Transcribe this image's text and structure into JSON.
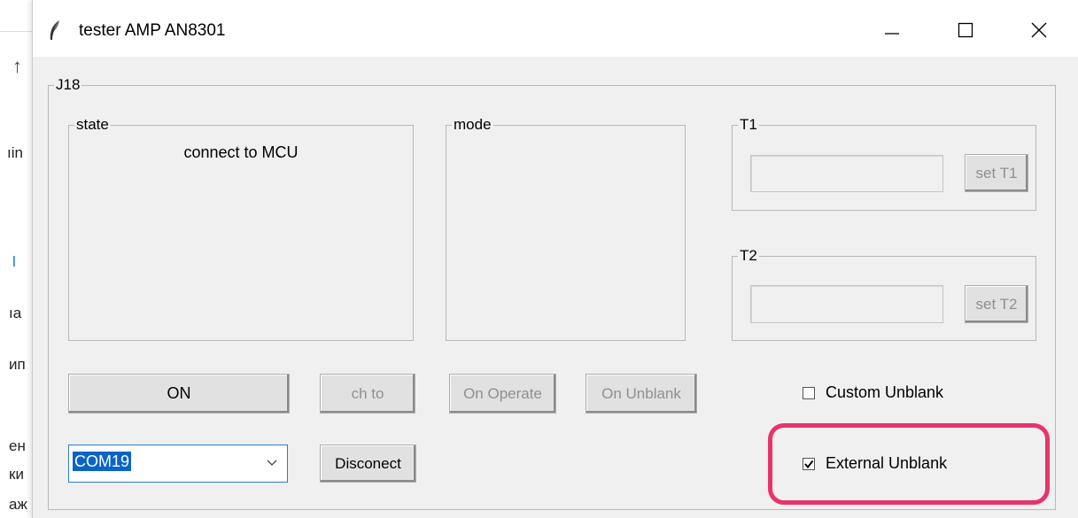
{
  "background": {
    "fragments": [
      "ıin",
      "ıа",
      "ип",
      "ен",
      "ки",
      "аж"
    ],
    "blue_fragment": "l"
  },
  "window": {
    "title": "tester AMP AN8301",
    "icons": {
      "app": "feather-icon",
      "minimize": "minimize-icon",
      "maximize": "maximize-icon",
      "close": "close-icon"
    }
  },
  "main_group": {
    "label": "J18"
  },
  "state": {
    "label": "state",
    "text": "connect to MCU"
  },
  "mode": {
    "label": "mode"
  },
  "t1": {
    "label": "T1",
    "value": "",
    "button": "set T1"
  },
  "t2": {
    "label": "T2",
    "value": "",
    "button": "set T2"
  },
  "buttons": {
    "on": "ON",
    "ch_to": "ch to",
    "on_operate": "On Operate",
    "on_unblank": "On Unblank",
    "disconnect": "Disconect"
  },
  "port": {
    "selected": "COM19",
    "icon": "chevron-down-icon"
  },
  "checkboxes": {
    "custom_unblank": {
      "label": "Custom Unblank",
      "checked": false
    },
    "external_unblank": {
      "label": "External Unblank",
      "checked": true
    }
  },
  "colors": {
    "highlight": "#e8336b",
    "selection": "#0a64c8",
    "window_bg": "#f0f0f0"
  }
}
